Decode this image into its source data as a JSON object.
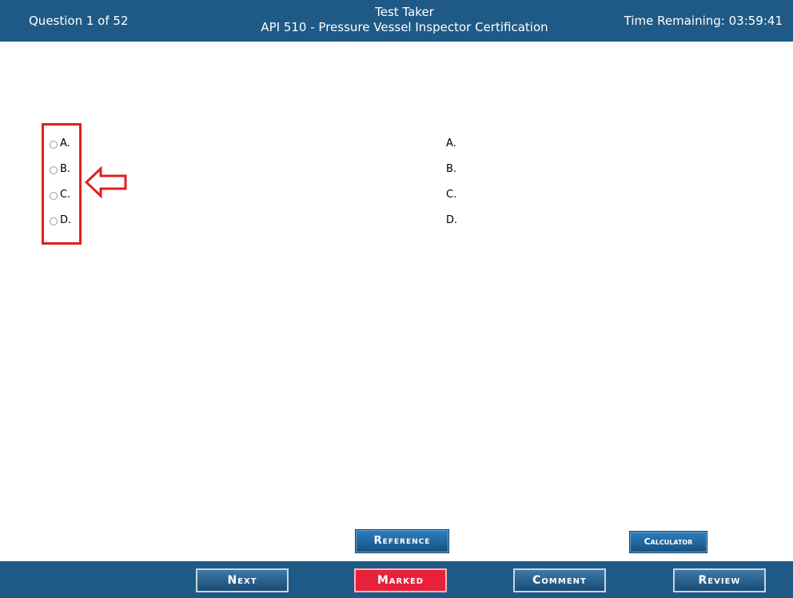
{
  "header": {
    "question_counter": "Question 1 of 52",
    "user_name": "Test Taker",
    "exam_title": "API 510 - Pressure Vessel Inspector Certification",
    "time_remaining": "Time Remaining: 03:59:41"
  },
  "answers": {
    "left": [
      {
        "label": "A.",
        "selected": false
      },
      {
        "label": "B.",
        "selected": false
      },
      {
        "label": "C.",
        "selected": false
      },
      {
        "label": "D.",
        "selected": false
      }
    ],
    "right": [
      {
        "label": "A."
      },
      {
        "label": "B."
      },
      {
        "label": "C."
      },
      {
        "label": "D."
      }
    ]
  },
  "annotation": {
    "highlight_color": "#e02020",
    "arrow_icon": "arrow-left-outline-icon"
  },
  "tools": {
    "reference_label": "Reference",
    "calculator_label": "Calculator"
  },
  "footer": {
    "next_label": "Next",
    "marked_label": "Marked",
    "comment_label": "Comment",
    "review_label": "Review"
  },
  "colors": {
    "bar_background": "#1f5a86",
    "marked_button": "#e8213a",
    "tool_button": "#1f6aa3"
  }
}
